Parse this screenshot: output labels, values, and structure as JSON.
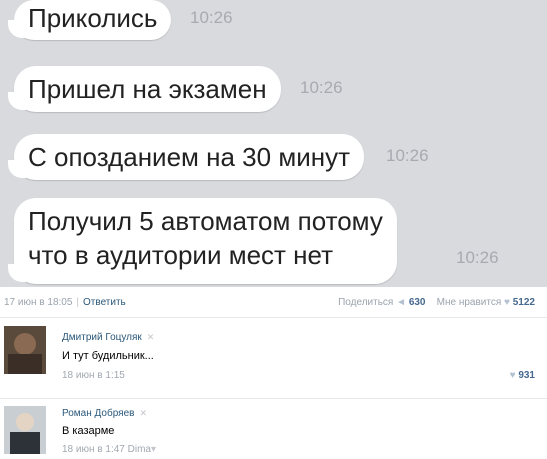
{
  "messages": [
    {
      "text": "Приколись",
      "time": "10:26"
    },
    {
      "text": "Пришел на экзамен",
      "time": "10:26"
    },
    {
      "text": "С опозданием на 30 минут",
      "time": "10:26"
    },
    {
      "text_line1": "Получил 5 автоматом потому",
      "text_line2": "что в аудитории мест нет",
      "time": "10:26"
    }
  ],
  "post_footer": {
    "date": "17 июн в 18:05",
    "reply_label": "Ответить",
    "share_label": "Поделиться",
    "share_count": "630",
    "like_label": "Мне нравится",
    "like_count": "5122"
  },
  "comments": [
    {
      "author": "Дмитрий Гоцуляк",
      "text": "И тут будильник...",
      "meta": "18 июн в 1:15",
      "likes": "931"
    },
    {
      "author": "Роман Добряев",
      "text": "В казарме",
      "meta": "18 июн в 1:47",
      "reply_to": "Dima"
    }
  ],
  "icons": {
    "remove": "✕",
    "share": "megaphone-icon",
    "like": "heart-icon"
  },
  "colors": {
    "chat_bg": "#d8dade",
    "link": "#2b587a",
    "timestamp": "#a7aab0"
  }
}
